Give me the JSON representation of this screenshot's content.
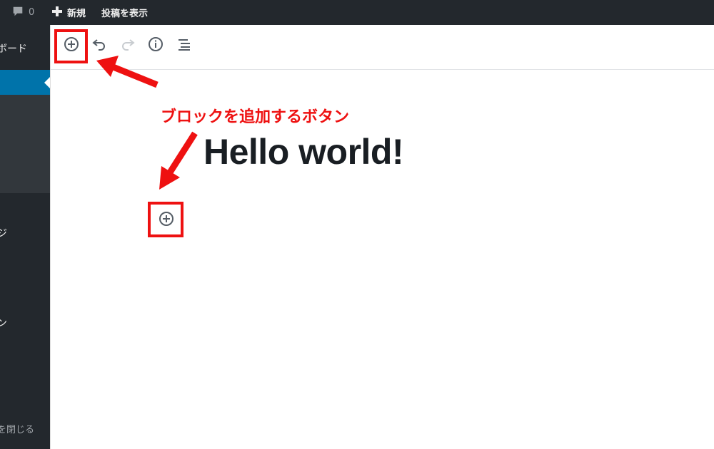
{
  "admin_bar": {
    "comments_count": "0",
    "new_label": "新規",
    "view_post_label": "投稿を表示"
  },
  "admin_menu": {
    "dashboard_label": "ボード",
    "pages_label": "ジ",
    "appearance_label": "ン",
    "collapse_label": "を閉じる"
  },
  "editor": {
    "toolbar_icons": [
      "add-block-icon",
      "undo-icon",
      "redo-icon",
      "info-icon",
      "outline-icon"
    ],
    "post_title": "Hello world!"
  },
  "annotation": {
    "callout_text": "ブロックを追加するボタン",
    "color": "#ee1111"
  },
  "colors": {
    "admin_bg": "#23282d",
    "menu_current": "#0073aa",
    "submenu_bg": "#32373c"
  }
}
